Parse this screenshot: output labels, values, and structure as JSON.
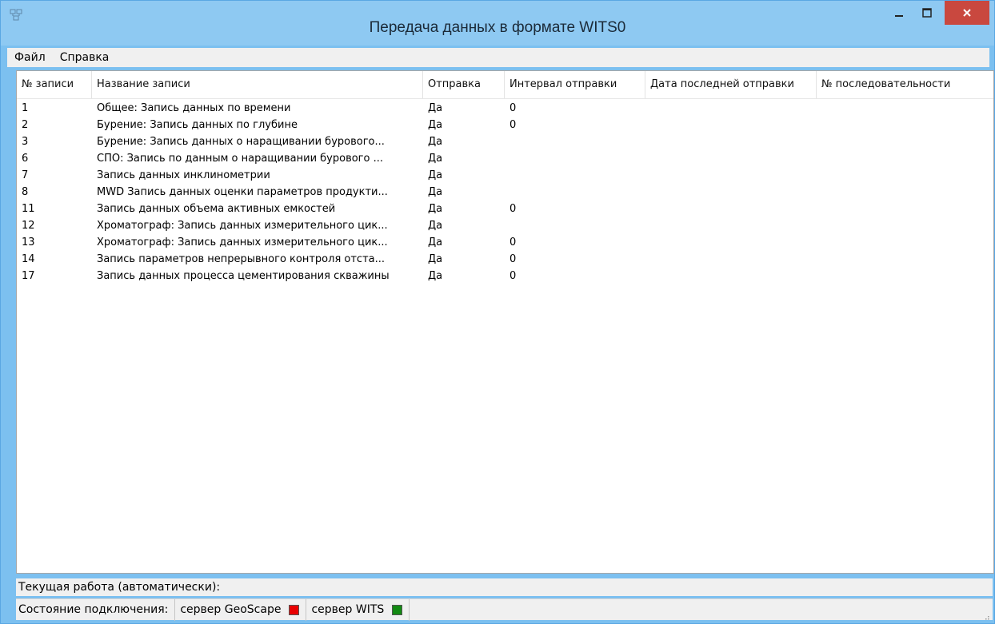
{
  "window": {
    "title": "Передача данных в формате WITS0"
  },
  "menu": {
    "file": "Файл",
    "help": "Справка"
  },
  "table": {
    "columns": [
      "№ записи",
      "Название записи",
      "Отправка",
      "Интервал отправки",
      "Дата последней отправки",
      "№ последовательности"
    ],
    "rows": [
      {
        "num": "1",
        "name": "Общее: Запись данных по времени",
        "send": "Да",
        "interval": "0"
      },
      {
        "num": "2",
        "name": "Бурение: Запись данных  по глубине",
        "send": "Да",
        "interval": "0"
      },
      {
        "num": "3",
        "name": "Бурение: Запись данных о наращивании бурового...",
        "send": "Да",
        "interval": ""
      },
      {
        "num": "6",
        "name": "СПО: Запись по данным о наращивании бурового ...",
        "send": "Да",
        "interval": ""
      },
      {
        "num": "7",
        "name": "Запись данных инклинометрии",
        "send": "Да",
        "interval": ""
      },
      {
        "num": "8",
        "name": "MWD Запись данных оценки параметров продукти...",
        "send": "Да",
        "interval": ""
      },
      {
        "num": "11",
        "name": "Запись данных объема активных емкостей",
        "send": "Да",
        "interval": "0"
      },
      {
        "num": "12",
        "name": "Хроматограф: Запись данных измерительного цик...",
        "send": "Да",
        "interval": ""
      },
      {
        "num": "13",
        "name": "Хроматограф: Запись данных измерительного цик...",
        "send": "Да",
        "interval": "0"
      },
      {
        "num": "14",
        "name": "Запись параметров непрерывного контроля отста...",
        "send": "Да",
        "interval": "0"
      },
      {
        "num": "17",
        "name": "Запись данных процесса цементирования скважины",
        "send": "Да",
        "interval": "0"
      }
    ]
  },
  "status": {
    "current_work": "Текущая работа (автоматически):",
    "connection_label": "Состояние подключения:",
    "geoscape_label": "сервер GeoScape",
    "wits_label": "сервер WITS"
  },
  "colors": {
    "geoscape_status": "#e80000",
    "wits_status": "#138a13",
    "titlebar": "#8ec9f2",
    "close_button": "#c9483f"
  }
}
